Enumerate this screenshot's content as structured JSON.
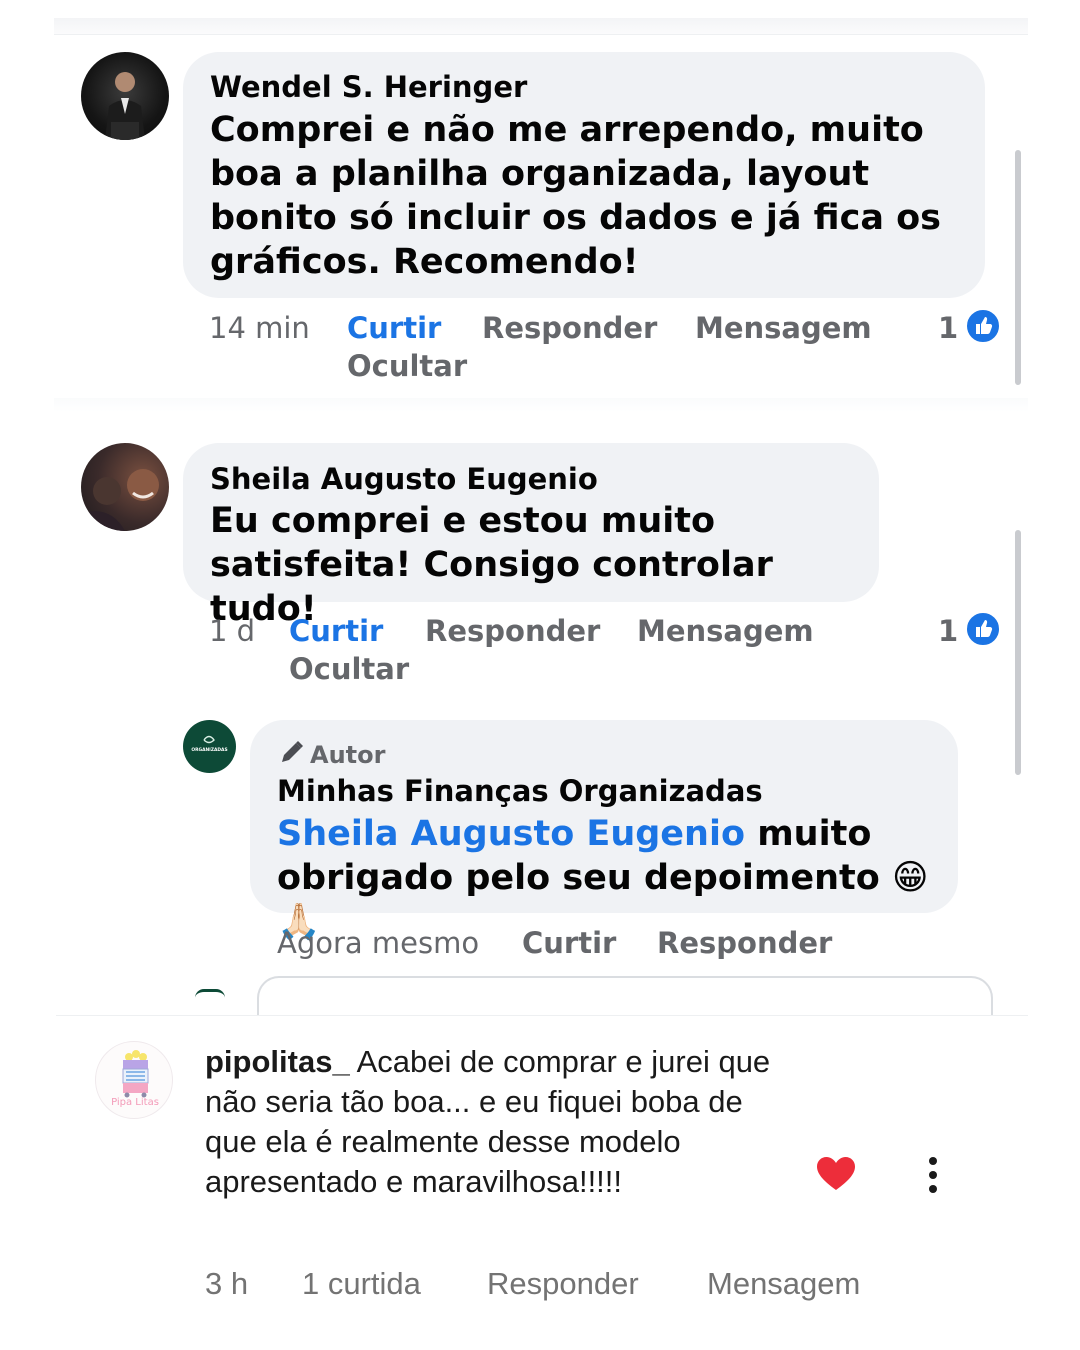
{
  "comment1": {
    "author": "Wendel S. Heringer",
    "text": "Comprei e não me arrependo, muito boa a planilha organizada, layout bonito só incluir os dados e já fica os gráficos. Recomendo!",
    "time": "14 min",
    "like_label": "Curtir",
    "reply_label": "Responder",
    "message_label": "Mensagem",
    "hide_label": "Ocultar",
    "reactions": "1"
  },
  "comment2": {
    "author": "Sheila Augusto Eugenio",
    "text": "Eu comprei e estou muito satisfeita! Consigo controlar tudo!",
    "time": "1 d",
    "like_label": "Curtir",
    "reply_label": "Responder",
    "message_label": "Mensagem",
    "hide_label": "Ocultar",
    "reactions": "1"
  },
  "reply": {
    "badge": "Autor",
    "author": "Minhas Finanças Organizadas",
    "avatar_text": "ORGANIZADAS",
    "mention": "Sheila Augusto Eugenio",
    "text_after_mention": " muito obrigado pelo seu depoimento ",
    "emoji1": "😁",
    "emoji2": "🙏🏻",
    "time": "Agora mesmo",
    "like_label": "Curtir",
    "reply_label": "Responder"
  },
  "instagram": {
    "username": "pipolitas_",
    "text": "Acabei de comprar e jurei que não seria tão boa... e eu fiquei boba de que ela é realmente desse modelo apresentado e maravilhosa!!!!!",
    "avatar_label": "Pipa Litas",
    "time": "3 h",
    "likes": "1 curtida",
    "reply_label": "Responder",
    "message_label": "Mensagem"
  },
  "colors": {
    "link_blue": "#1b74e4",
    "bubble_gray": "#f0f2f5",
    "action_gray": "#65676b",
    "heart_red": "#ed2d3a",
    "author_avatar_green": "#0d4a37"
  },
  "icons": [
    "like-thumb-icon",
    "pencil-icon",
    "heart-icon",
    "more-vertical-icon"
  ]
}
